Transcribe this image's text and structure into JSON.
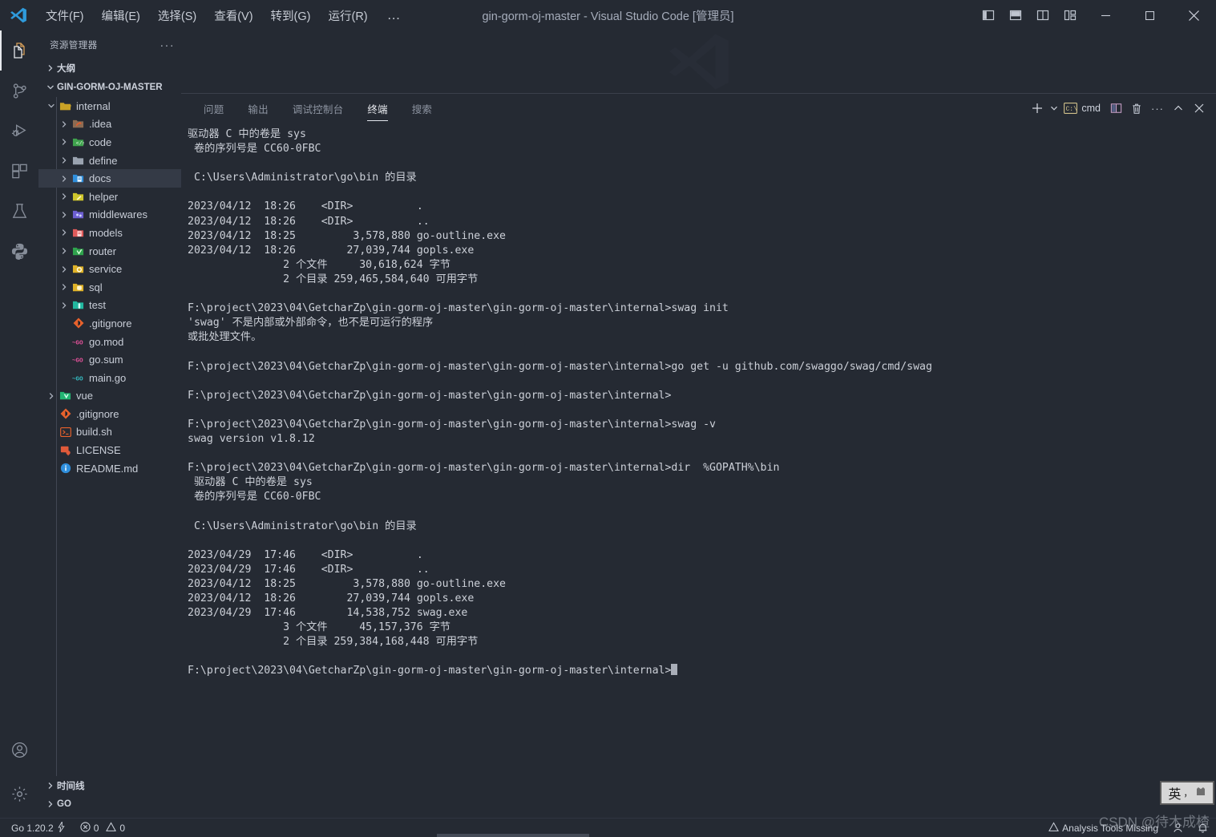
{
  "window": {
    "title": "gin-gorm-oj-master - Visual Studio Code [管理员]",
    "menus": [
      {
        "label": "文件(F)",
        "name": "menu-file"
      },
      {
        "label": "编辑(E)",
        "name": "menu-edit"
      },
      {
        "label": "选择(S)",
        "name": "menu-selection"
      },
      {
        "label": "查看(V)",
        "name": "menu-view"
      },
      {
        "label": "转到(G)",
        "name": "menu-go"
      },
      {
        "label": "运行(R)",
        "name": "menu-run"
      }
    ],
    "menu_more": "…",
    "layout_buttons": [
      "toggle-primary-sidebar",
      "toggle-panel",
      "toggle-secondary-sidebar",
      "customize-layout"
    ],
    "controls": {
      "minimize": "—",
      "maximize": "▢",
      "close": "✕"
    }
  },
  "activitybar": {
    "items": [
      {
        "name": "explorer",
        "icon": "files-icon",
        "active": true
      },
      {
        "name": "source-control",
        "icon": "source-control-icon",
        "active": false
      },
      {
        "name": "run-and-debug",
        "icon": "debug-icon",
        "active": false
      },
      {
        "name": "extensions",
        "icon": "extensions-icon",
        "active": false
      },
      {
        "name": "testing",
        "icon": "beaker-icon",
        "active": false
      },
      {
        "name": "python",
        "icon": "python-icon",
        "active": false
      }
    ],
    "bottom": [
      {
        "name": "accounts",
        "icon": "account-icon"
      },
      {
        "name": "manage",
        "icon": "gear-icon"
      }
    ]
  },
  "sidebar": {
    "title": "资源管理器",
    "more": "···",
    "outline_section": "大纲",
    "project_section": "GIN-GORM-OJ-MASTER",
    "tree": [
      {
        "label": "internal",
        "depth": 1,
        "arrow": "down",
        "icon": "folder-open",
        "color": "#c9a227",
        "selected": false
      },
      {
        "label": ".idea",
        "depth": 2,
        "arrow": "right",
        "icon": "folder-idea",
        "color": "#8c6b52",
        "selected": false
      },
      {
        "label": "code",
        "depth": 2,
        "arrow": "right",
        "icon": "folder-code",
        "color": "#3fa34d",
        "selected": false
      },
      {
        "label": "define",
        "depth": 2,
        "arrow": "right",
        "icon": "folder-plain",
        "color": "#9aa3b0",
        "selected": false
      },
      {
        "label": "docs",
        "depth": 2,
        "arrow": "right",
        "icon": "folder-docs",
        "color": "#2f8fdd",
        "selected": true
      },
      {
        "label": "helper",
        "depth": 2,
        "arrow": "right",
        "icon": "folder-helper",
        "color": "#cfc62c",
        "selected": false
      },
      {
        "label": "middlewares",
        "depth": 2,
        "arrow": "right",
        "icon": "folder-mid",
        "color": "#6d5fd0",
        "selected": false
      },
      {
        "label": "models",
        "depth": 2,
        "arrow": "right",
        "icon": "folder-models",
        "color": "#e05a5a",
        "selected": false
      },
      {
        "label": "router",
        "depth": 2,
        "arrow": "right",
        "icon": "folder-router",
        "color": "#2fa34d",
        "selected": false
      },
      {
        "label": "service",
        "depth": 2,
        "arrow": "right",
        "icon": "folder-service",
        "color": "#e0b328",
        "selected": false
      },
      {
        "label": "sql",
        "depth": 2,
        "arrow": "right",
        "icon": "folder-sql",
        "color": "#e0b328",
        "selected": false
      },
      {
        "label": "test",
        "depth": 2,
        "arrow": "right",
        "icon": "folder-test",
        "color": "#22b8a0",
        "selected": false
      },
      {
        "label": ".gitignore",
        "depth": 2,
        "arrow": "none",
        "icon": "git-icon",
        "color": "#e8622c",
        "selected": false
      },
      {
        "label": "go.mod",
        "depth": 2,
        "arrow": "none",
        "icon": "go-icon",
        "color": "#e6529c",
        "selected": false
      },
      {
        "label": "go.sum",
        "depth": 2,
        "arrow": "none",
        "icon": "go-icon",
        "color": "#e6529c",
        "selected": false
      },
      {
        "label": "main.go",
        "depth": 2,
        "arrow": "none",
        "icon": "go-icon",
        "color": "#35bec4",
        "selected": false
      },
      {
        "label": "vue",
        "depth": 1,
        "arrow": "right",
        "icon": "folder-vue",
        "color": "#22b573",
        "selected": false
      },
      {
        "label": ".gitignore",
        "depth": 1,
        "arrow": "none",
        "icon": "git-icon",
        "color": "#e8622c",
        "selected": false
      },
      {
        "label": "build.sh",
        "depth": 1,
        "arrow": "none",
        "icon": "shell-icon",
        "color": "#e8622c",
        "selected": false
      },
      {
        "label": "LICENSE",
        "depth": 1,
        "arrow": "none",
        "icon": "license-icon",
        "color": "#e05a3a",
        "selected": false
      },
      {
        "label": "README.md",
        "depth": 1,
        "arrow": "none",
        "icon": "info-icon",
        "color": "#2f8fdd",
        "selected": false
      }
    ],
    "footer": [
      {
        "label": "时间线",
        "name": "timeline"
      },
      {
        "label": "GO",
        "name": "go-view"
      }
    ]
  },
  "panel": {
    "tabs": [
      {
        "label": "问题",
        "name": "tab-problems",
        "active": false
      },
      {
        "label": "输出",
        "name": "tab-output",
        "active": false
      },
      {
        "label": "调试控制台",
        "name": "tab-debug-console",
        "active": false
      },
      {
        "label": "终端",
        "name": "tab-terminal",
        "active": true
      },
      {
        "label": "搜索",
        "name": "tab-search",
        "active": false
      }
    ],
    "actions": {
      "new_terminal": "+",
      "dropdown": "⌄",
      "shell_label": "cmd",
      "split": "split-terminal",
      "kill": "kill-terminal",
      "more": "···",
      "maximize": "^",
      "close": "✕"
    }
  },
  "terminal": {
    "lines": [
      "驱动器 C 中的卷是 sys",
      " 卷的序列号是 CC60-0FBC",
      "",
      " C:\\Users\\Administrator\\go\\bin 的目录",
      "",
      "2023/04/12  18:26    <DIR>          .",
      "2023/04/12  18:26    <DIR>          ..",
      "2023/04/12  18:25         3,578,880 go-outline.exe",
      "2023/04/12  18:26        27,039,744 gopls.exe",
      "               2 个文件     30,618,624 字节",
      "               2 个目录 259,465,584,640 可用字节",
      "",
      "F:\\project\\2023\\04\\GetcharZp\\gin-gorm-oj-master\\gin-gorm-oj-master\\internal>swag init",
      "'swag' 不是内部或外部命令，也不是可运行的程序",
      "或批处理文件。",
      "",
      "F:\\project\\2023\\04\\GetcharZp\\gin-gorm-oj-master\\gin-gorm-oj-master\\internal>go get -u github.com/swaggo/swag/cmd/swag",
      "",
      "F:\\project\\2023\\04\\GetcharZp\\gin-gorm-oj-master\\gin-gorm-oj-master\\internal>",
      "",
      "F:\\project\\2023\\04\\GetcharZp\\gin-gorm-oj-master\\gin-gorm-oj-master\\internal>swag -v",
      "swag version v1.8.12",
      "",
      "F:\\project\\2023\\04\\GetcharZp\\gin-gorm-oj-master\\gin-gorm-oj-master\\internal>dir  %GOPATH%\\bin",
      " 驱动器 C 中的卷是 sys",
      " 卷的序列号是 CC60-0FBC",
      "",
      " C:\\Users\\Administrator\\go\\bin 的目录",
      "",
      "2023/04/29  17:46    <DIR>          .",
      "2023/04/29  17:46    <DIR>          ..",
      "2023/04/12  18:25         3,578,880 go-outline.exe",
      "2023/04/12  18:26        27,039,744 gopls.exe",
      "2023/04/29  17:46        14,538,752 swag.exe",
      "               3 个文件     45,157,376 字节",
      "               2 个目录 259,384,168,448 可用字节",
      ""
    ],
    "prompt_line": "F:\\project\\2023\\04\\GetcharZp\\gin-gorm-oj-master\\gin-gorm-oj-master\\internal>"
  },
  "statusbar": {
    "left": [
      {
        "label": "Go 1.20.2",
        "icon": "lightning-icon",
        "name": "go-version"
      },
      {
        "label": "0",
        "icon": "error-icon",
        "label2": "0",
        "icon2": "warning-icon",
        "name": "problems-counts"
      }
    ],
    "right": [
      {
        "label": "Analysis Tools Missing",
        "icon": "warning-icon",
        "name": "analysis-tools-missing"
      },
      {
        "label": "",
        "icon": "account-icon",
        "name": "status-account"
      },
      {
        "label": "",
        "icon": "bell-icon",
        "name": "notifications"
      }
    ]
  },
  "ime": {
    "mode": "英",
    "punct": "，",
    "tool": "ime-tool"
  },
  "watermark": "CSDN @待木成楂"
}
